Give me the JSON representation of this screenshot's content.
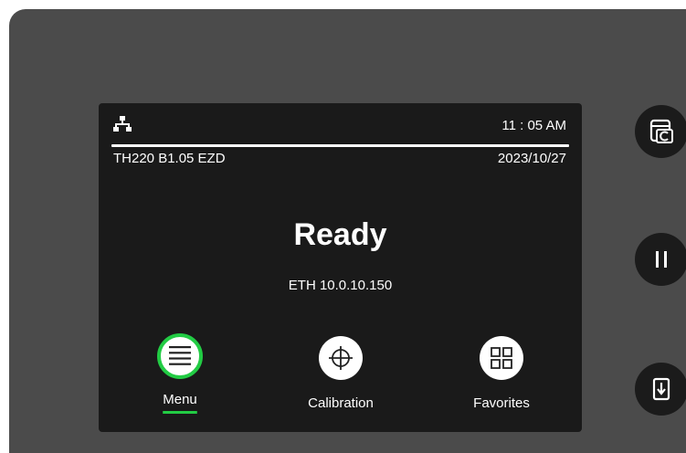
{
  "header": {
    "time": "11 : 05 AM",
    "model": "TH220 B1.05 EZD",
    "date": "2023/10/27"
  },
  "status": {
    "state": "Ready",
    "network": "ETH 10.0.10.150"
  },
  "nav": {
    "menu_label": "Menu",
    "calibration_label": "Calibration",
    "favorites_label": "Favorites"
  },
  "icons": {
    "network": "network-icon",
    "menu": "hamburger-icon",
    "calibration": "crosshair-icon",
    "favorites": "grid-icon",
    "feed": "print-feed-icon",
    "pause": "pause-icon",
    "cut": "media-exit-icon"
  },
  "colors": {
    "accent": "#22cc44",
    "panel": "#4b4b4b",
    "screen": "#1a1a1a"
  }
}
